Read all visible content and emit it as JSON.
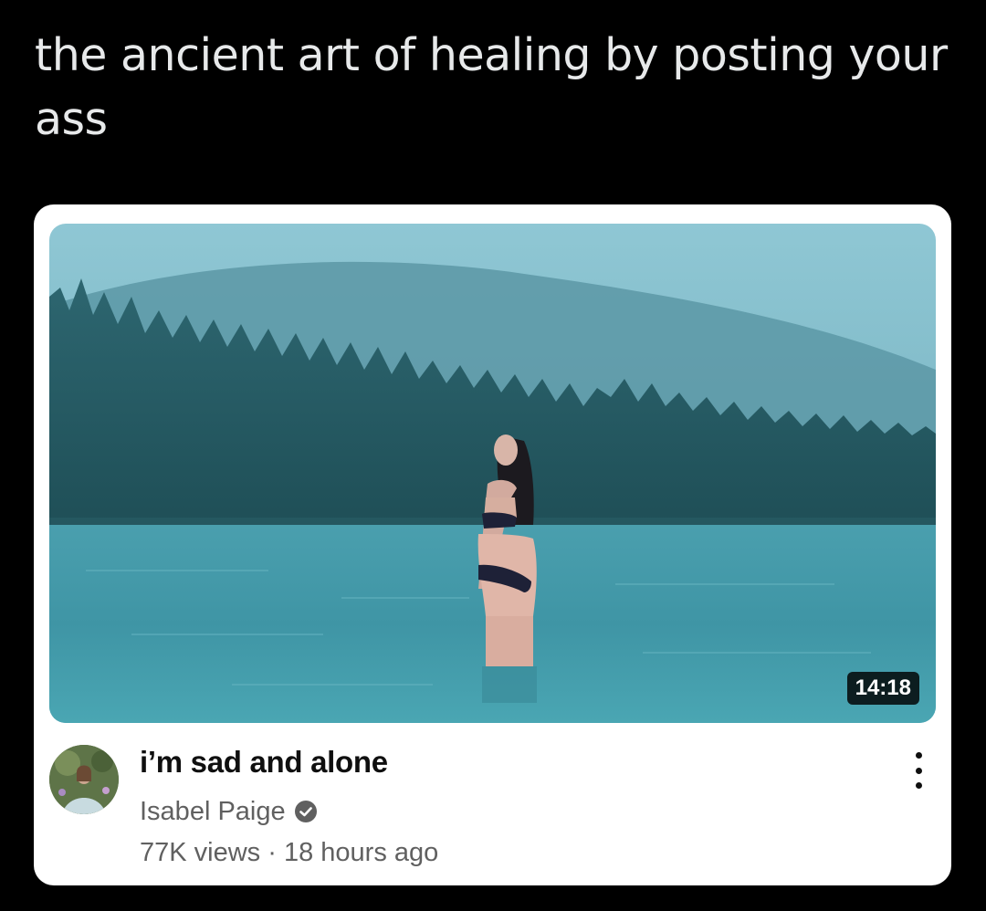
{
  "tweet": {
    "text": "the ancient art of healing by posting your ass"
  },
  "video": {
    "duration": "14:18",
    "title": "i’m sad and alone",
    "channel": "Isabel Paige",
    "views": "77K views",
    "separator": "·",
    "age": "18 hours ago",
    "verified_icon": "verified-check-icon",
    "menu_icon": "more-vertical-icon"
  },
  "colors": {
    "background": "#000000",
    "tweet_text": "#e7e9ea",
    "card": "#ffffff",
    "title": "#0f0f0f",
    "secondary": "#606060"
  }
}
